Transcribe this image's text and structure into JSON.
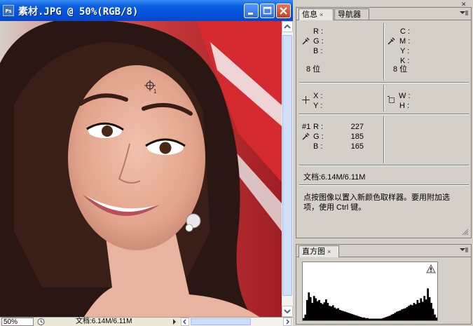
{
  "document": {
    "app_icon": "Ps",
    "title": "素材.JPG @ 50%(RGB/8)",
    "zoom": "50%",
    "status_text": "文档:6.14M/6.11M"
  },
  "info_panel": {
    "tabs": [
      {
        "label": "信息",
        "close": "×"
      },
      {
        "label": "导航器"
      }
    ],
    "rgb_labels": [
      "R :",
      "G :",
      "B :"
    ],
    "cmyk_labels": [
      "C :",
      "M :",
      "Y :",
      "K :"
    ],
    "bit_depth_left": "8 位",
    "bit_depth_right": "8 位",
    "xy_labels": [
      "X :",
      "Y :"
    ],
    "wh_labels": [
      "W :",
      "H :"
    ],
    "sampler": {
      "id": "#1",
      "labels": [
        "R :",
        "G :",
        "B :"
      ],
      "values": [
        "227",
        "185",
        "165"
      ]
    },
    "doc_size": "文档:6.14M/6.11M",
    "hint": "点按图像以置入新颜色取样器。要用附加选项，使用 Ctrl 键。"
  },
  "histogram_panel": {
    "tab": {
      "label": "直方图",
      "close": "×"
    },
    "warning_icon": "warning-icon",
    "levels": [
      0.04,
      0.1,
      0.35,
      0.48,
      0.4,
      0.3,
      0.42,
      0.38,
      0.33,
      0.35,
      0.3,
      0.28,
      0.31,
      0.36,
      0.3,
      0.25,
      0.24,
      0.26,
      0.22,
      0.2,
      0.21,
      0.18,
      0.17,
      0.16,
      0.15,
      0.14,
      0.13,
      0.12,
      0.11,
      0.1,
      0.09,
      0.08,
      0.07,
      0.06,
      0.05,
      0.05,
      0.04,
      0.04,
      0.03,
      0.03,
      0.03,
      0.03,
      0.03,
      0.03,
      0.03,
      0.03,
      0.04,
      0.05,
      0.06,
      0.07,
      0.08,
      0.1,
      0.11,
      0.13,
      0.15,
      0.16,
      0.17,
      0.19,
      0.2,
      0.21,
      0.23,
      0.25,
      0.27,
      0.26,
      0.3,
      0.28,
      0.35,
      0.3,
      0.38,
      0.32,
      0.42,
      0.36,
      0.55,
      0.4,
      0.3,
      0.2,
      0.1,
      0.05
    ]
  },
  "sampler_marker": "1",
  "colors": {
    "title_blue": "#0450d8",
    "panel_gray": "#d4d0c8",
    "close_red": "#c4401c"
  }
}
